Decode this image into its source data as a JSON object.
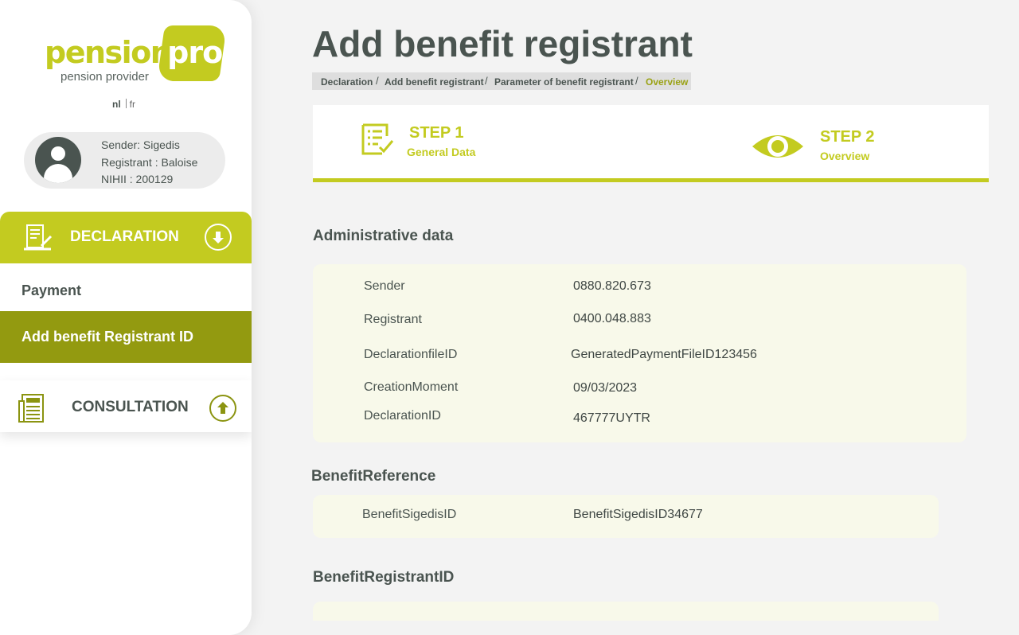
{
  "brand": {
    "word": "pension",
    "badge": "pro",
    "tagline": "pension provider",
    "color": "#c3cb20"
  },
  "language": {
    "active": "nl",
    "other": "fr"
  },
  "user": {
    "sender": "Sender: Sigedis",
    "registrant": "Registrant : Baloise",
    "nihii": "NIHII : 200129"
  },
  "sidebar": {
    "declaration": {
      "label": "DECLARATION",
      "icon": "document-pen-icon",
      "toggle_icon": "arrow-down-circle-icon"
    },
    "items": [
      {
        "label": "Payment",
        "active": false
      },
      {
        "label": "Add benefit Registrant ID",
        "active": true
      }
    ],
    "consultation": {
      "label": "CONSULTATION",
      "icon": "document-list-icon",
      "toggle_icon": "arrow-up-circle-icon"
    }
  },
  "page": {
    "title": "Add benefit registrant"
  },
  "breadcrumb": [
    "Declaration",
    "Add benefit registrant",
    "Parameter of benefit registrant",
    "Overview"
  ],
  "steps": [
    {
      "title": "STEP 1",
      "subtitle": "General Data",
      "icon": "checklist-icon"
    },
    {
      "title": "STEP 2",
      "subtitle": "Overview",
      "icon": "eye-icon"
    }
  ],
  "sections": {
    "administrative": {
      "title": "Administrative data",
      "rows": [
        {
          "label": "Sender",
          "value": "0880.820.673"
        },
        {
          "label": "Registrant",
          "value": "0400.048.883"
        },
        {
          "label": "DeclarationfileID",
          "value": "GeneratedPaymentFileID123456"
        },
        {
          "label": "CreationMoment",
          "value": "09/03/2023"
        },
        {
          "label": "DeclarationID",
          "value": "467777UYTR"
        }
      ]
    },
    "benefit_reference": {
      "title": "BenefitReference",
      "rows": [
        {
          "label": "BenefitSigedisID",
          "value": "BenefitSigedisID34677"
        }
      ]
    },
    "benefit_registrant": {
      "title": "BenefitRegistrantID"
    }
  },
  "colors": {
    "accent": "#c3cb20",
    "active_item": "#939a10",
    "text": "#4a5450",
    "panel": "#f8f9ea"
  }
}
